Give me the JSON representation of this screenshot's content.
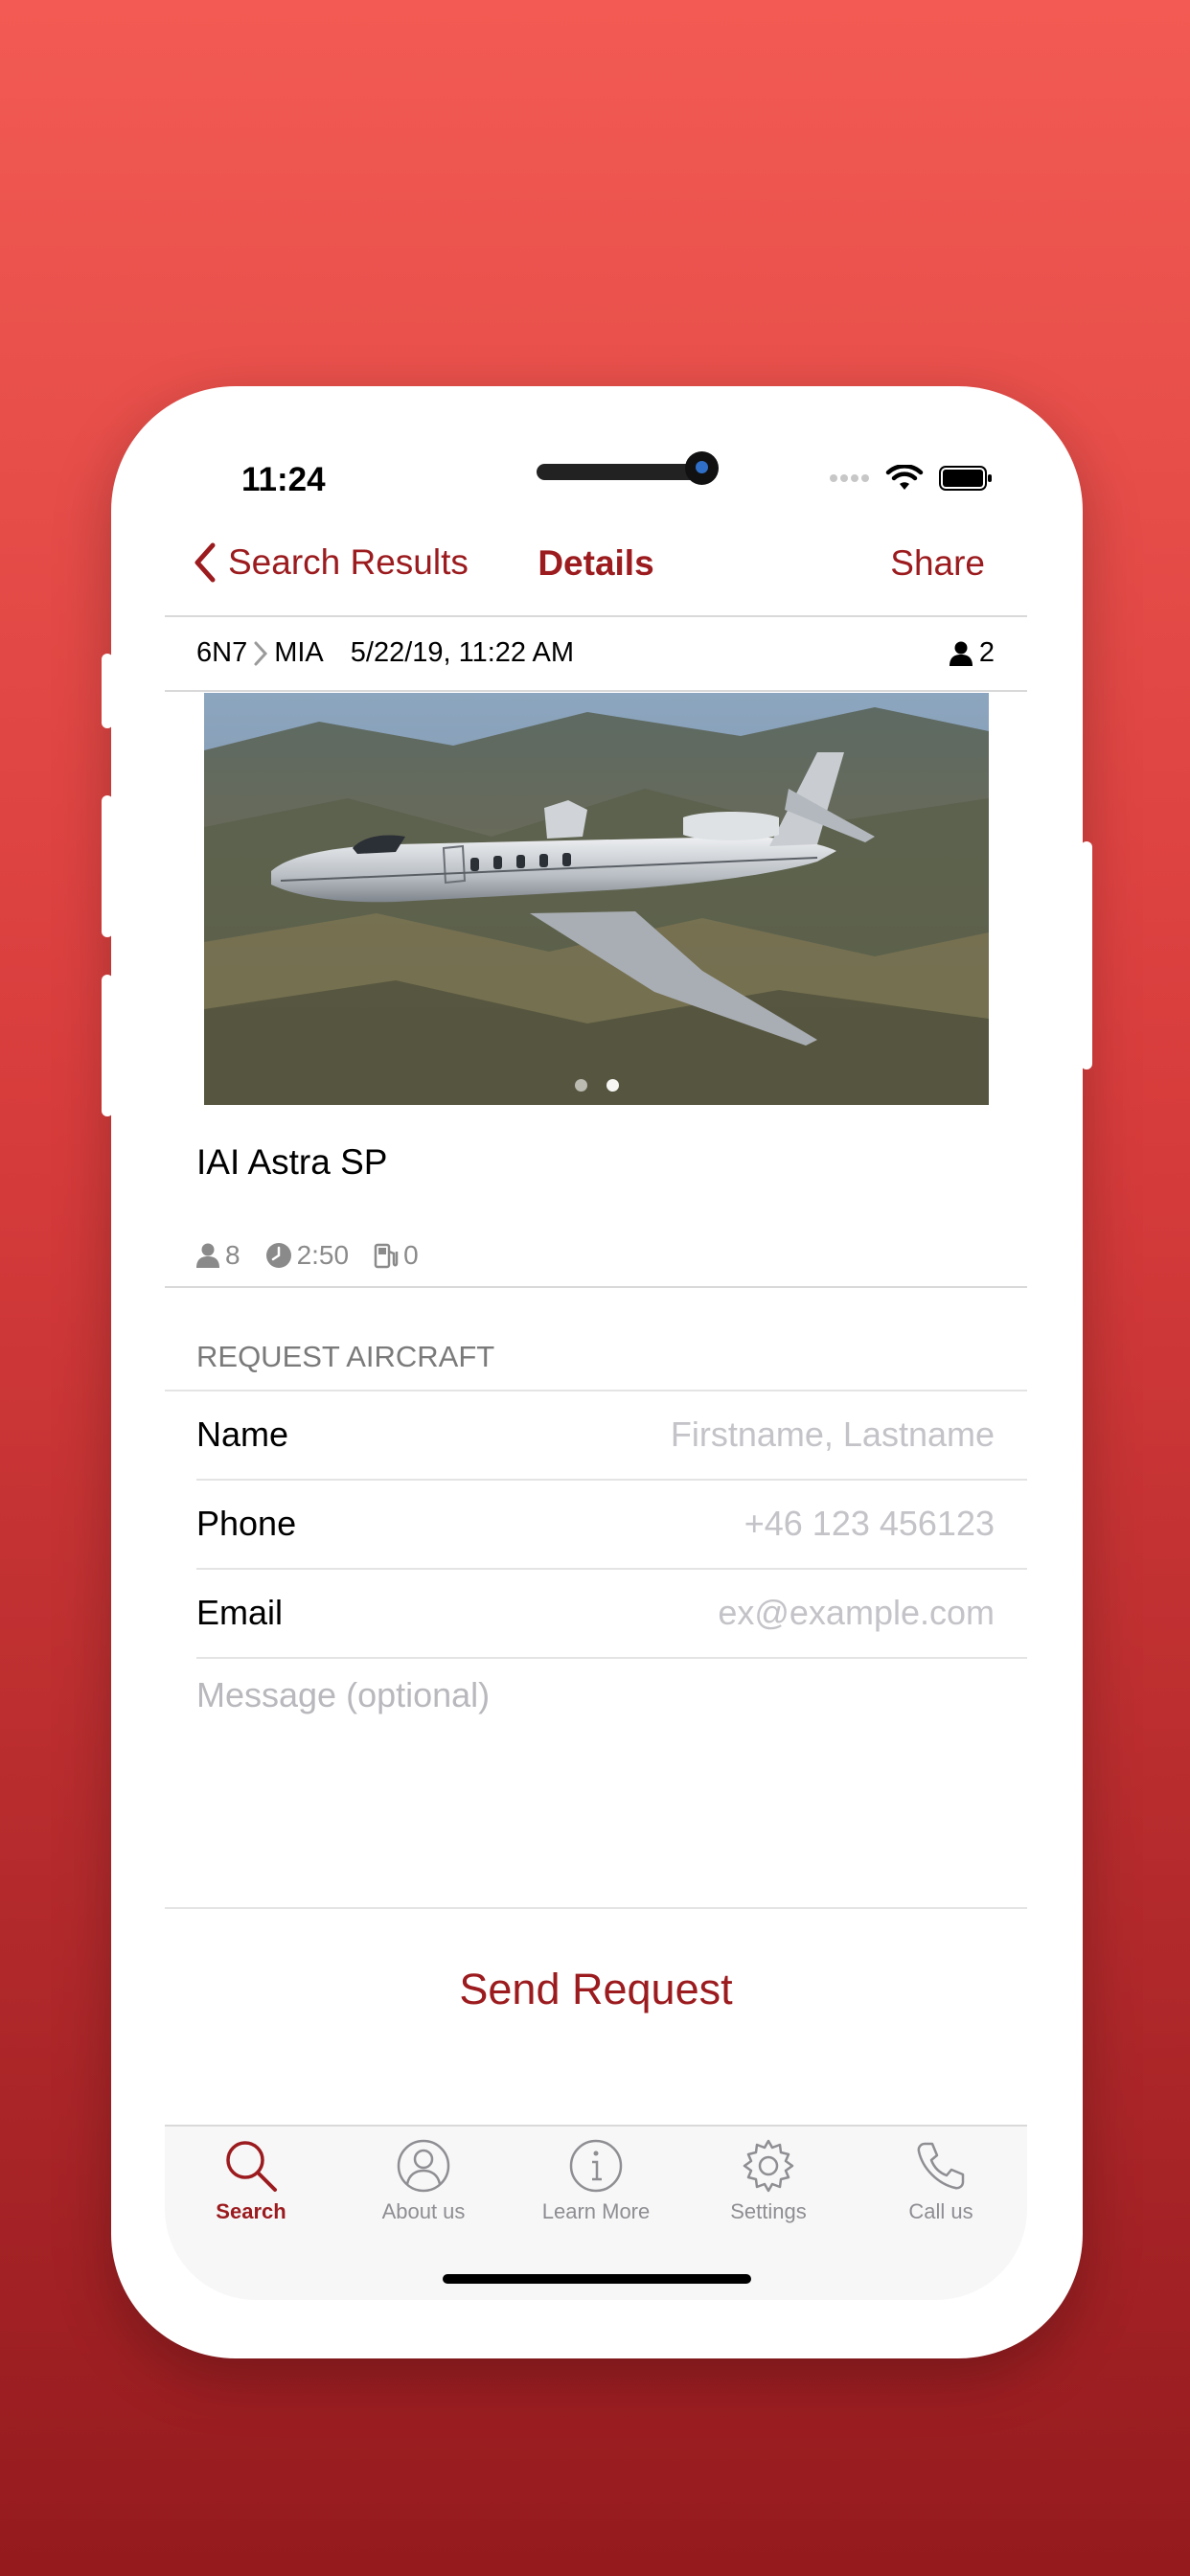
{
  "status_bar": {
    "time": "11:24"
  },
  "nav": {
    "back_label": "Search Results",
    "title": "Details",
    "share_label": "Share"
  },
  "trip": {
    "from": "6N7",
    "to": "MIA",
    "datetime": "5/22/19, 11:22 AM",
    "passengers": "2"
  },
  "gallery": {
    "page_count": 2,
    "active_page": 2
  },
  "aircraft": {
    "name": "IAI Astra SP",
    "seats": "8",
    "duration": "2:50",
    "fuel_stops": "0"
  },
  "form": {
    "section_title": "REQUEST AIRCRAFT",
    "name_label": "Name",
    "name_placeholder": "Firstname, Lastname",
    "name_value": "",
    "phone_label": "Phone",
    "phone_placeholder": "+46 123 456123",
    "phone_value": "",
    "email_label": "Email",
    "email_placeholder": "ex@example.com",
    "email_value": "",
    "message_placeholder": "Message (optional)",
    "send_label": "Send Request"
  },
  "tabs": [
    {
      "label": "Search",
      "icon": "search-icon",
      "active": true
    },
    {
      "label": "About us",
      "icon": "person-circle-icon",
      "active": false
    },
    {
      "label": "Learn More",
      "icon": "info-icon",
      "active": false
    },
    {
      "label": "Settings",
      "icon": "gear-icon",
      "active": false
    },
    {
      "label": "Call us",
      "icon": "phone-icon",
      "active": false
    }
  ],
  "colors": {
    "accent": "#9b1b1e",
    "background_top": "#f25a53",
    "background_bottom": "#941a1e"
  }
}
